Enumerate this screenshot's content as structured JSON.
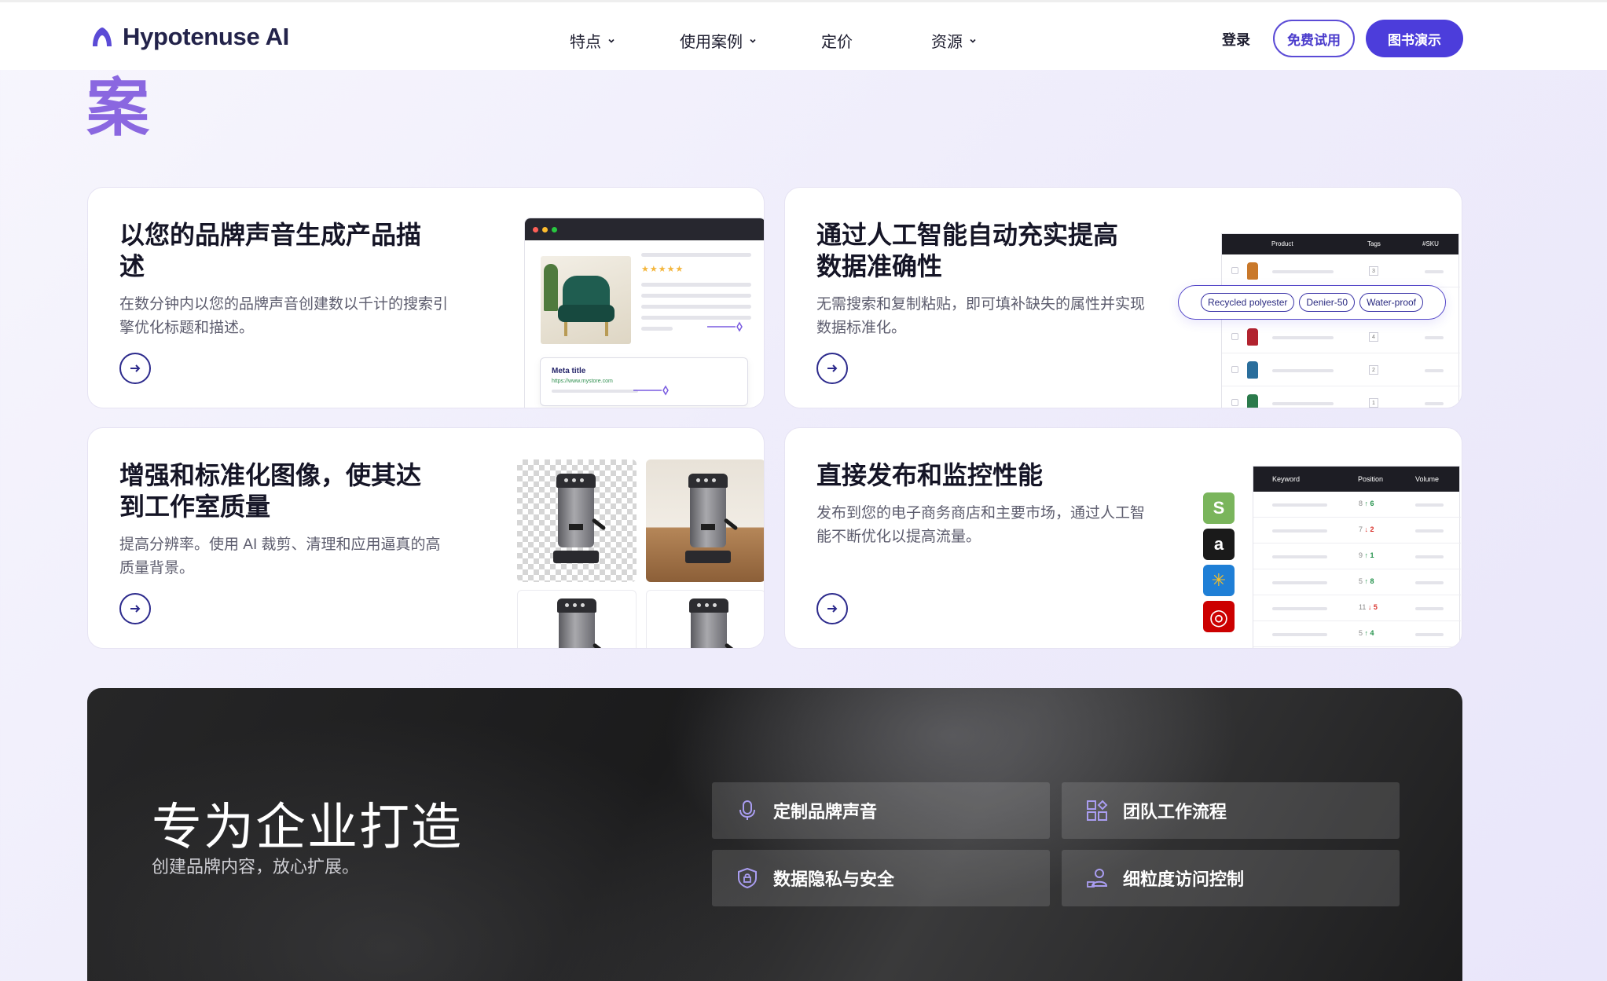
{
  "brand": {
    "name": "Hypotenuse AI",
    "accent": "#4c3ddb",
    "logo_color": "#5b4bd6"
  },
  "nav": {
    "items": [
      {
        "label": "特点",
        "dropdown": true
      },
      {
        "label": "使用案例",
        "dropdown": true
      },
      {
        "label": "定价",
        "dropdown": false
      },
      {
        "label": "资源",
        "dropdown": true
      }
    ],
    "login": "登录",
    "trial_button": "免费试用",
    "demo_button": "图书演示"
  },
  "hero": {
    "partial_heading": "案"
  },
  "cards": [
    {
      "title": "以您的品牌声音生成产品描述",
      "description": "在数分钟内以您的品牌声音创建数以千计的搜索引擎优化标题和描述。",
      "arrow_icon": "arrow-right-icon",
      "mock": {
        "rating": "★★★★★",
        "meta_title": "Meta title",
        "meta_url": "https://www.mystore.com"
      }
    },
    {
      "title": "通过人工智能自动充实提高数据准确性",
      "description": "无需搜索和复制粘贴，即可填补缺失的属性并实现数据标准化。",
      "arrow_icon": "arrow-right-icon",
      "table": {
        "headers": [
          "Product",
          "Tags",
          "#SKU"
        ],
        "rows": [
          {
            "tag_count": "3",
            "color": "#c9782a"
          },
          {
            "tag_count": "4",
            "color": "#b2232f"
          },
          {
            "tag_count": "2",
            "color": "#2a6e9c"
          },
          {
            "tag_count": "1",
            "color": "#2b7a4b"
          }
        ],
        "tags": [
          "Recycled polyester",
          "Denier-50",
          "Water-proof"
        ]
      }
    },
    {
      "title": "增强和标准化图像，使其达到工作室质量",
      "description": "提高分辨率。使用 AI 裁剪、清理和应用逼真的高质量背景。",
      "arrow_icon": "arrow-right-icon"
    },
    {
      "title": "直接发布和监控性能",
      "description": "发布到您的电子商务商店和主要市场，通过人工智能不断优化以提高流量。",
      "arrow_icon": "arrow-right-icon",
      "stores": [
        {
          "name": "shopify-icon",
          "glyph": "S",
          "color": "#7ab55c"
        },
        {
          "name": "amazon-icon",
          "glyph": "a",
          "color": "#1a1a1a"
        },
        {
          "name": "walmart-icon",
          "glyph": "✳",
          "color": "#1f7fd6"
        },
        {
          "name": "target-icon",
          "glyph": "◎",
          "color": "#cc0000"
        }
      ],
      "keywords": {
        "headers": [
          "Keyword",
          "Position",
          "Volume"
        ],
        "rows": [
          {
            "from": "8",
            "dir": "up",
            "to": "6"
          },
          {
            "from": "7",
            "dir": "down",
            "to": "2"
          },
          {
            "from": "9",
            "dir": "up",
            "to": "1"
          },
          {
            "from": "5",
            "dir": "up",
            "to": "8"
          },
          {
            "from": "11",
            "dir": "down",
            "to": "5"
          },
          {
            "from": "5",
            "dir": "up",
            "to": "4"
          }
        ]
      }
    }
  ],
  "enterprise": {
    "title": "专为企业打造",
    "subtitle": "创建品牌内容，放心扩展。",
    "features": [
      {
        "label": "定制品牌声音",
        "icon": "microphone-icon"
      },
      {
        "label": "团队工作流程",
        "icon": "workflow-grid-icon"
      },
      {
        "label": "数据隐私与安全",
        "icon": "shield-lock-icon"
      },
      {
        "label": "细粒度访问控制",
        "icon": "user-access-icon"
      }
    ]
  }
}
